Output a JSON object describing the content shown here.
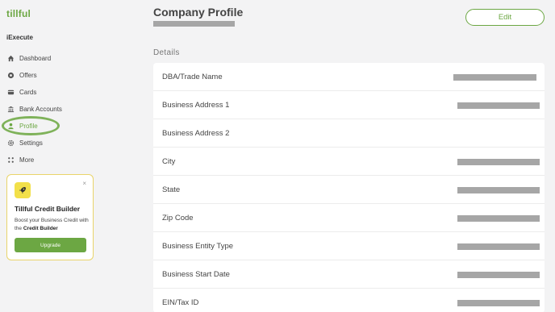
{
  "app": {
    "brand": "tillful",
    "org_name": "iExecute"
  },
  "sidebar": {
    "items": [
      {
        "label": "Dashboard",
        "icon": "home-icon",
        "active": false
      },
      {
        "label": "Offers",
        "icon": "offers-icon",
        "active": false
      },
      {
        "label": "Cards",
        "icon": "card-icon",
        "active": false
      },
      {
        "label": "Bank Accounts",
        "icon": "bank-icon",
        "active": false
      },
      {
        "label": "Profile",
        "icon": "user-icon",
        "active": true
      },
      {
        "label": "Settings",
        "icon": "gear-icon",
        "active": false
      },
      {
        "label": "More",
        "icon": "grid-icon",
        "active": false
      }
    ]
  },
  "promo": {
    "title": "Tillful Credit Builder",
    "text_prefix": "Boost your Business Credit with the ",
    "text_bold": "Credit Builder",
    "button_label": "Upgrade",
    "close_symbol": "×",
    "icon": "rocket-icon"
  },
  "main": {
    "title": "Company Profile",
    "edit_label": "Edit",
    "section_label": "Details",
    "fields": [
      {
        "label": "DBA/Trade Name"
      },
      {
        "label": "Business Address 1"
      },
      {
        "label": "Business Address 2"
      },
      {
        "label": "City"
      },
      {
        "label": "State"
      },
      {
        "label": "Zip Code"
      },
      {
        "label": "Business Entity Type"
      },
      {
        "label": "Business Start Date"
      },
      {
        "label": "EIN/Tax ID"
      }
    ]
  },
  "colors": {
    "brand_green": "#6ca743",
    "promo_border": "#e9d46a",
    "promo_icon_bg": "#f2e04a",
    "redaction_gray": "#a6a6a6"
  }
}
